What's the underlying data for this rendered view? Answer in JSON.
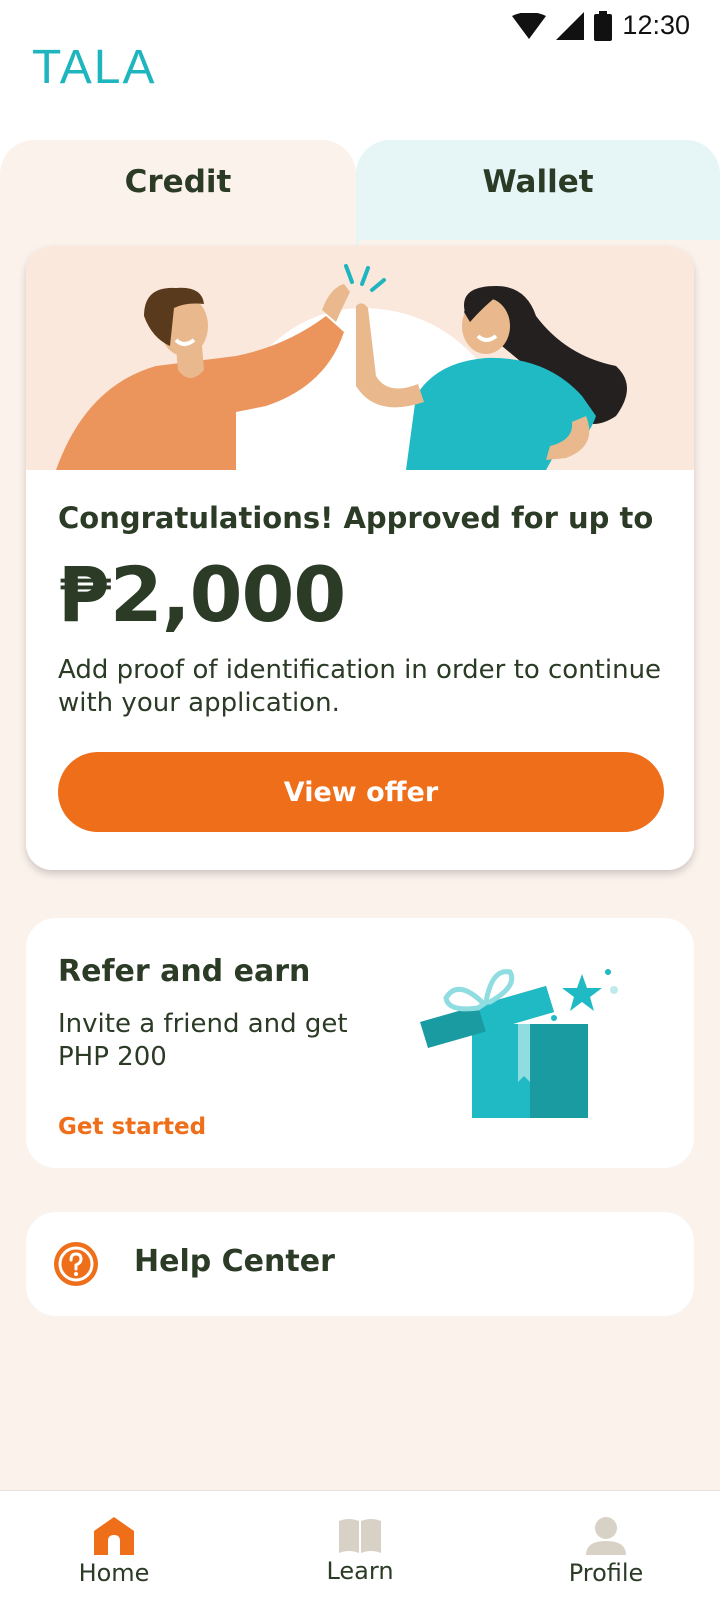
{
  "status_bar": {
    "time": "12:30",
    "icons": [
      "wifi-icon",
      "signal-icon",
      "battery-icon"
    ]
  },
  "header": {
    "logo_text": "TALA"
  },
  "tabs": [
    {
      "label": "Credit",
      "selected": true
    },
    {
      "label": "Wallet",
      "selected": false
    }
  ],
  "offer_card": {
    "headline": "Congratulations! Approved for up to",
    "amount": "₱2,000",
    "message": "Add proof of identification in order to continue with your application.",
    "button_label": "View offer",
    "illustration": "high-five-illustration"
  },
  "refer_card": {
    "title": "Refer and earn",
    "description": "Invite a friend and get PHP 200",
    "link_label": "Get started",
    "illustration": "gift-box-illustration"
  },
  "help_card": {
    "label": "Help Center",
    "icon": "question-circle-icon"
  },
  "bottom_nav": {
    "items": [
      {
        "label": "Home",
        "icon": "home-icon",
        "active": true
      },
      {
        "label": "Learn",
        "icon": "book-icon",
        "active": false
      },
      {
        "label": "Profile",
        "icon": "person-icon",
        "active": false
      }
    ]
  },
  "colors": {
    "brand_teal": "#1fb5bf",
    "accent_orange": "#ef6e1a",
    "text_dark": "#2b3b26",
    "page_background": "#fcf2ec",
    "wallet_tab_background": "#e6f6f6"
  }
}
